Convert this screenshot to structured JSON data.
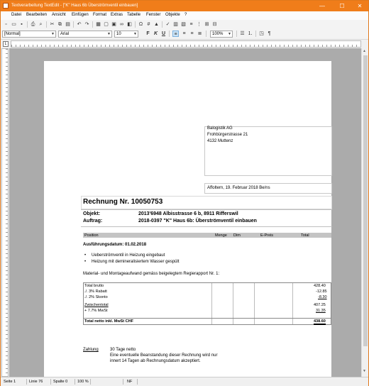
{
  "window": {
    "title": "Textverarbeitung TextEdit - [\"K\" Haus 6b Überströmventil einbauen]",
    "controls": {
      "minimize": "—",
      "maximize": "☐",
      "close": "✕"
    }
  },
  "menu": [
    "Datei",
    "Bearbeiten",
    "Ansicht",
    "Einfügen",
    "Format",
    "Extras",
    "Tabelle",
    "Fenster",
    "Objekte",
    "?"
  ],
  "format_bar": {
    "style": "[Normal]",
    "font": "Arial",
    "size": "10",
    "bold": "F",
    "italic": "K",
    "underline": "U",
    "zoom": "100%",
    "pilcrow": "¶"
  },
  "document": {
    "address": [
      "Balogistik AG",
      "Frohbürgerstrasse 21",
      "4132 Muttenz"
    ],
    "date_line": "Affoltern, 19. Februar 2018 Be/ns",
    "invoice_title": "Rechnung Nr. 10050753",
    "object_label": "Objekt:",
    "object_value": "2013'6948 Albisstrasse 6 b, 8911 Rifferswil",
    "order_label": "Auftrag:",
    "order_value": "2018-0397 \"K\" Haus 6b: Überströmventil einbauen",
    "columns": [
      "Position",
      "Menge",
      "Dim",
      "E-Preis",
      "Total"
    ],
    "execution_date": "Ausführungsdatum: 01.02.2018",
    "bullets": [
      "Ueberströmventil in Heizung eingebaut",
      "Heizung mit demineralisiertem Wasser gespült"
    ],
    "intro_text": "Material- und Montageaufwand gemäss beigelegtem Regierapport Nr. 1:",
    "totals": [
      {
        "label": "Total brutto",
        "value": "428.40"
      },
      {
        "label": "./. 3% Rabatt",
        "value": "-12.85"
      },
      {
        "label": "./. 2% Skonto",
        "value": "-8.30"
      },
      {
        "label": "Zwischentotal",
        "value": "407.25"
      },
      {
        "label": "+ 7.7% MwSt",
        "value": "31.35"
      }
    ],
    "total_net_label": "Total netto inkl. MwSt CHF",
    "total_net_value": "438.60",
    "payment_label": "Zahlung",
    "payment_lines": [
      "30 Tage netto",
      "Eine eventuelle Beanstandung dieser Rechnung wird nur",
      "innert 14 Tagen ab Rechnungsdatum akzeptiert."
    ]
  },
  "status": {
    "page": "Seite 1",
    "line": "Linie 76",
    "column": "Spalte 0",
    "zoom": "100 %",
    "nf": "NF"
  }
}
